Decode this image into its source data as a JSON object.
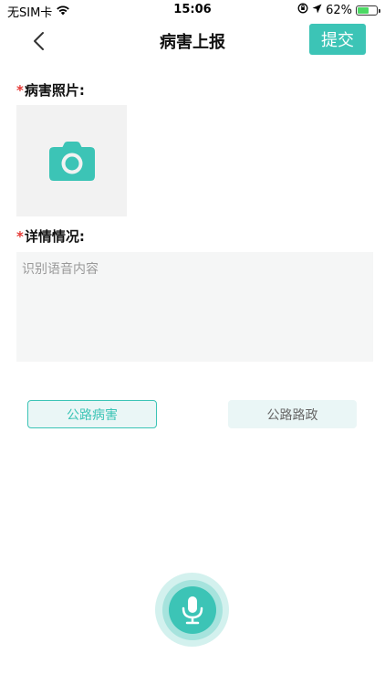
{
  "status_bar": {
    "carrier": "无SIM卡",
    "time": "15:06",
    "battery_percent_label": "62%",
    "battery_level": 0.62
  },
  "nav": {
    "title": "病害上报",
    "submit_label": "提交"
  },
  "form": {
    "photo_label_star": "*",
    "photo_label": "病害照片:",
    "detail_label_star": "*",
    "detail_label": "详情情况:",
    "detail_placeholder": "识别语音内容",
    "detail_value": ""
  },
  "categories": [
    {
      "label": "公路病害",
      "selected": true
    },
    {
      "label": "公路路政",
      "selected": false
    }
  ],
  "colors": {
    "accent": "#3cc4b6",
    "required_star": "#e53935"
  },
  "icons": {
    "back": "chevron-left-icon",
    "camera": "camera-icon",
    "microphone": "microphone-icon",
    "wifi": "wifi-icon",
    "location": "location-arrow-icon",
    "lock_rotation": "orientation-lock-icon",
    "battery": "battery-icon"
  }
}
